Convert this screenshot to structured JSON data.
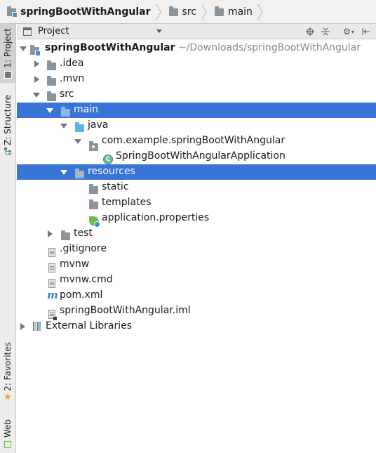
{
  "breadcrumb": {
    "items": [
      {
        "label": "springBootWithAngular",
        "icon": "project-folder-icon"
      },
      {
        "label": "src",
        "icon": "folder-icon"
      },
      {
        "label": "main",
        "icon": "folder-icon"
      }
    ]
  },
  "panel": {
    "title": "Project",
    "toolbar_icons": [
      "locate-icon",
      "collapse-all-icon",
      "gear-icon",
      "hide-icon"
    ]
  },
  "sidebar": {
    "tabs": [
      {
        "label": "1: Project",
        "icon": "project-icon"
      },
      {
        "label": "Z: Structure",
        "icon": "structure-icon"
      },
      {
        "label": "2: Favorites",
        "icon": "star-icon"
      },
      {
        "label": "Web",
        "icon": "web-icon"
      }
    ]
  },
  "tree": {
    "root": {
      "name": "springBootWithAngular",
      "path": "~/Downloads/springBootWithAngular"
    },
    "items": [
      {
        "label": ".idea"
      },
      {
        "label": ".mvn"
      },
      {
        "label": "src"
      },
      {
        "label": "main"
      },
      {
        "label": "java"
      },
      {
        "label": "com.example.springBootWithAngular"
      },
      {
        "label": "SpringBootWithAngularApplication"
      },
      {
        "label": "resources"
      },
      {
        "label": "static"
      },
      {
        "label": "templates"
      },
      {
        "label": "application.properties"
      },
      {
        "label": "test"
      },
      {
        "label": ".gitignore"
      },
      {
        "label": "mvnw"
      },
      {
        "label": "mvnw.cmd"
      },
      {
        "label": "pom.xml"
      },
      {
        "label": "springBootWithAngular.iml"
      },
      {
        "label": "External Libraries"
      }
    ]
  },
  "colors": {
    "selection": "#3875d6",
    "source_folder": "#58b7e0",
    "folder": "#8b939b"
  }
}
